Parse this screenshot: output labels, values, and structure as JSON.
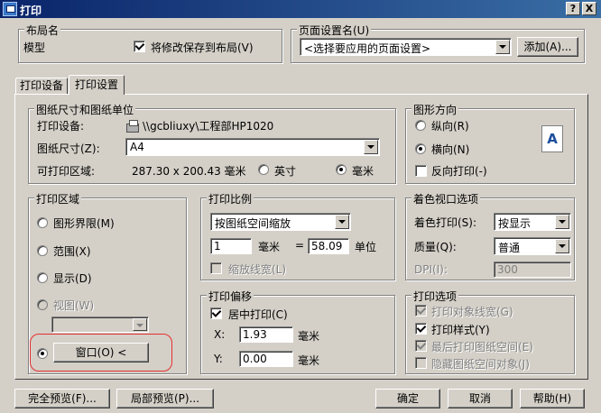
{
  "window": {
    "title": "打印",
    "help_button": "?",
    "close_button": "X"
  },
  "layout_group": {
    "label": "布局名",
    "name": "模型",
    "save_changes_label": "将修改保存到布局(V)",
    "save_changes_checked": true
  },
  "page_setup_group": {
    "label": "页面设置名(U)",
    "selected": "<选择要应用的页面设置>",
    "add_button": "添加(A)..."
  },
  "tabs": [
    {
      "label": "打印设备",
      "active": false
    },
    {
      "label": "打印设置",
      "active": true
    }
  ],
  "paper_group": {
    "label": "图纸尺寸和图纸单位",
    "device_label": "打印设备:",
    "device_value": "\\\\gcbliuxy\\工程部HP1020",
    "paper_size_label": "图纸尺寸(Z):",
    "paper_size_value": "A4",
    "printable_area_label": "可打印区域:",
    "printable_area_value": "287.30 x 200.43 毫米",
    "unit_inch": "英寸",
    "unit_mm": "毫米",
    "selected_unit": "毫米"
  },
  "orientation_group": {
    "label": "图形方向",
    "portrait": "纵向(R)",
    "landscape": "横向(N)",
    "selected": "横向(N)",
    "reverse_label": "反向打印(-)",
    "reverse_checked": false,
    "paper_icon_letter": "A"
  },
  "print_area_group": {
    "label": "打印区域",
    "limits": "图形界限(M)",
    "extents": "范围(X)",
    "display": "显示(D)",
    "view": "视图(W)",
    "selected": "窗口",
    "window_button": "窗口(O) <"
  },
  "scale_group": {
    "label": "打印比例",
    "scale_value": "按图纸空间缩放",
    "left_value": "1",
    "unit_mm": "毫米",
    "equals": "=",
    "right_value": "58.09",
    "unit_label": "单位",
    "scale_lineweights": "缩放线宽(L)",
    "scale_lineweights_checked": false
  },
  "viewport_group": {
    "label": "着色视口选项",
    "shade_label": "着色打印(S):",
    "shade_value": "按显示",
    "quality_label": "质量(Q):",
    "quality_value": "普通",
    "dpi_label": "DPI(I):",
    "dpi_value": "300"
  },
  "offset_group": {
    "label": "打印偏移",
    "center_label": "居中打印(C)",
    "center_checked": true,
    "x_label": "X:",
    "x_value": "1.93",
    "y_label": "Y:",
    "y_value": "0.00",
    "unit": "毫米"
  },
  "options_group": {
    "label": "打印选项",
    "items": [
      {
        "label": "打印对象线宽(G)",
        "checked": true,
        "disabled": true
      },
      {
        "label": "打印样式(Y)",
        "checked": true,
        "disabled": false
      },
      {
        "label": "最后打印图纸空间(E)",
        "checked": true,
        "disabled": true
      },
      {
        "label": "隐藏图纸空间对象(J)",
        "checked": false,
        "disabled": true
      }
    ]
  },
  "bottom_buttons": {
    "full_preview": "完全预览(F)...",
    "partial_preview": "局部预览(P)...",
    "ok": "确定",
    "cancel": "取消",
    "help": "帮助(H)"
  },
  "colors": {
    "titlebar_start": "#0a246a",
    "titlebar_end": "#3a6ea5",
    "dialog_face": "#d4d0c8",
    "highlight_circle": "#e53030"
  }
}
